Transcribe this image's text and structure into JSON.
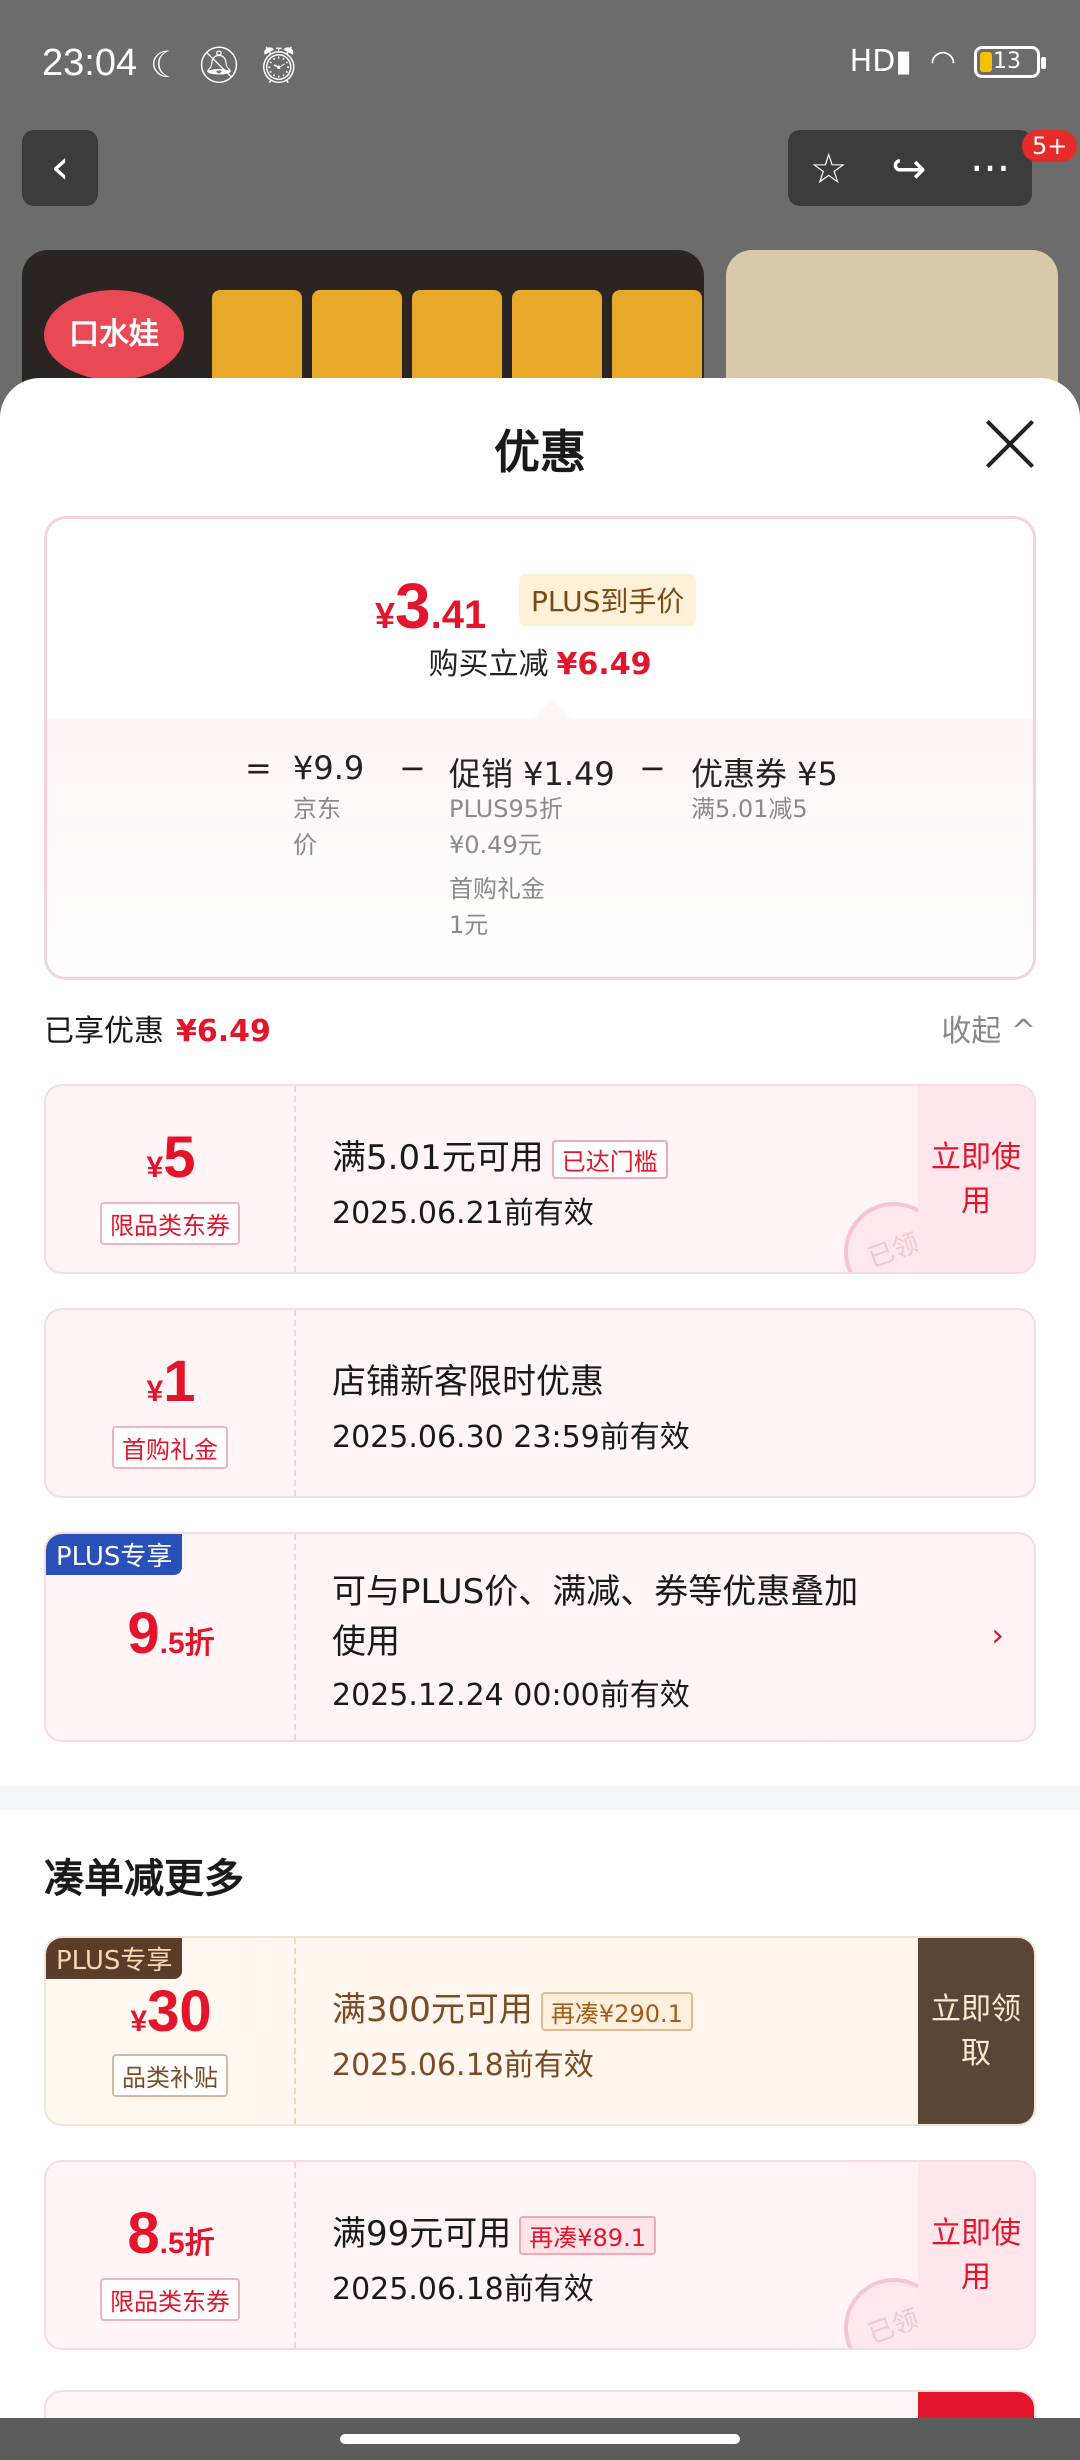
{
  "status_bar": {
    "time": "23:04",
    "left_icons": [
      "moon-icon",
      "bell-off-icon",
      "alarm-icon"
    ],
    "right_icons": [
      "hd-signal-icon",
      "wifi-icon"
    ],
    "battery": "13"
  },
  "nav": {
    "back_icon": "‹",
    "actions": [
      "star-icon",
      "share-icon",
      "more-icon"
    ],
    "badge": "5+"
  },
  "product": {
    "brand": "口水娃"
  },
  "sheet": {
    "title": "优惠",
    "price_card": {
      "currency": "¥",
      "price_int": "3",
      "price_dec": ".41",
      "plus_label": "PLUS到手价",
      "reduce_label": "购买立减",
      "reduce_amount": "¥6.49",
      "eq": "=",
      "base_price": "¥9.9",
      "base_label": "京东价",
      "minus1": "−",
      "promo": "促销 ¥1.49",
      "promo_detail_1": "PLUS95折",
      "promo_detail_1b": "¥0.49元",
      "promo_detail_2": "首购礼金",
      "promo_detail_2b": "1元",
      "minus2": "−",
      "coupon": "优惠券 ¥5",
      "coupon_detail": "满5.01减5"
    },
    "enjoyed": {
      "label": "已享优惠",
      "amount": "¥6.49",
      "collapse": "收起 ^"
    },
    "applied_coupons": [
      {
        "symbol": "¥",
        "amount": "5",
        "type": "限品类东券",
        "main": "满5.01元可用",
        "tag": "已达门槛",
        "sub": "2025.06.21前有效",
        "action": "立即使用",
        "stamp": "已领"
      },
      {
        "symbol": "¥",
        "amount": "1",
        "type": "首购礼金",
        "main": "店铺新客限时优惠",
        "sub": "2025.06.30 23:59前有效"
      },
      {
        "corner": "PLUS专享",
        "amount": "9",
        "suffix": ".5折",
        "main_line1": "可与PLUS价、满减、券等优惠叠加",
        "main_line2": "使用",
        "sub": "2025.12.24 00:00前有效",
        "chevron": "›"
      }
    ],
    "more_title": "凑单减更多",
    "more_coupons": [
      {
        "corner": "PLUS专享",
        "symbol": "¥",
        "amount": "30",
        "type": "品类补贴",
        "main": "满300元可用",
        "tag": "再凑¥290.1",
        "sub": "2025.06.18前有效",
        "action": "立即领取"
      },
      {
        "amount": "8",
        "suffix": ".5折",
        "type": "限品类东券",
        "main": "满99元可用",
        "tag": "再凑¥89.1",
        "sub": "2025.06.18前有效",
        "action": "立即使用",
        "stamp": "已领"
      }
    ]
  }
}
